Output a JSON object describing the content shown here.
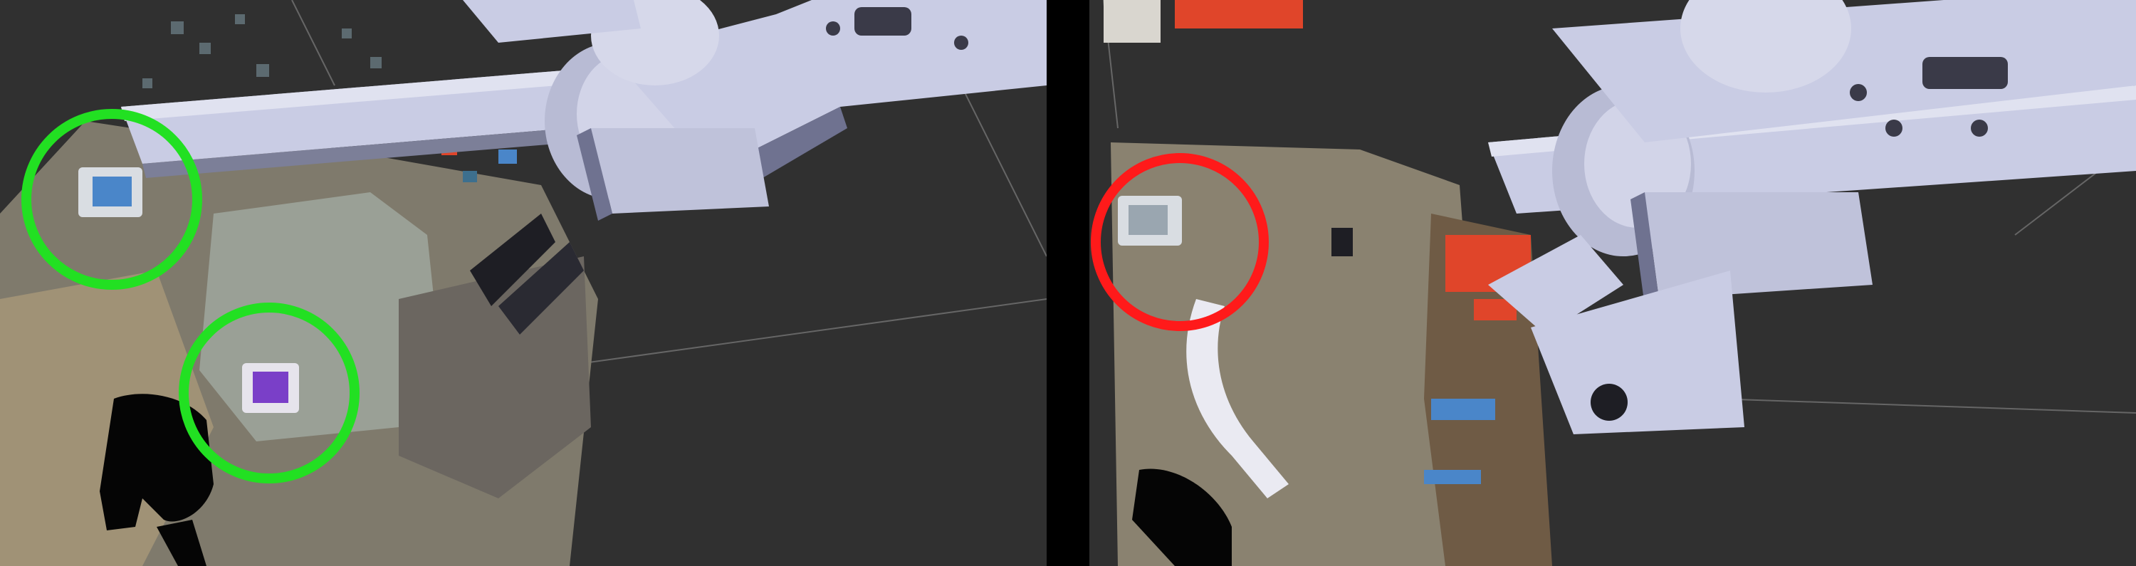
{
  "layout": {
    "panel_count": 2,
    "background_color": "#303030",
    "divider_color": "#000000"
  },
  "panels": [
    {
      "id": "left",
      "markers": [
        {
          "id": "marker-1",
          "color": "#22e022",
          "shape": "circle"
        },
        {
          "id": "marker-2",
          "color": "#22e022",
          "shape": "circle"
        }
      ]
    },
    {
      "id": "right",
      "markers": [
        {
          "id": "marker-1",
          "color": "#ff1a1a",
          "shape": "circle"
        }
      ]
    }
  ],
  "colors": {
    "robot_body": "#c9cce4",
    "robot_shadow": "#7c7f98",
    "grid_line": "#6a6a6a",
    "pointcloud_gray": "#8a8577",
    "pointcloud_warm": "#a79878",
    "object_blue": "#4a86c9",
    "object_purple": "#7a3fc8",
    "accent_red": "#e0452a"
  }
}
